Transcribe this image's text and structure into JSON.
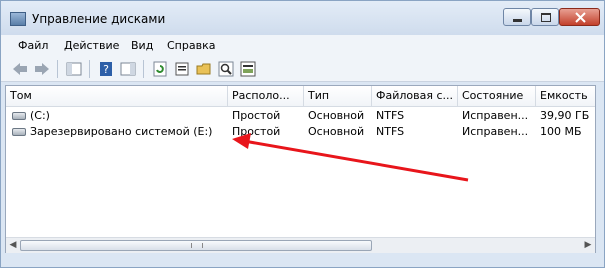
{
  "window": {
    "title": "Управление дисками"
  },
  "menu": [
    "Файл",
    "Действие",
    "Вид",
    "Справка"
  ],
  "toolbar": [
    "back-icon",
    "forward-icon",
    "console-tree-icon",
    "help-icon",
    "show-hide-icon",
    "refresh-icon",
    "properties-icon",
    "open-icon",
    "search-icon",
    "format-icon"
  ],
  "table": {
    "columns": [
      "Том",
      "Располо...",
      "Тип",
      "Файловая с...",
      "Состояние",
      "Емкость"
    ],
    "rows": [
      [
        "(C:)",
        "Простой",
        "Основной",
        "NTFS",
        "Исправен...",
        "39,90 ГБ"
      ],
      [
        "Зарезервировано системой (E:)",
        "Простой",
        "Основной",
        "NTFS",
        "Исправен...",
        "100 МБ"
      ]
    ]
  },
  "colors": {
    "accent_arrow": "#e8151b"
  }
}
